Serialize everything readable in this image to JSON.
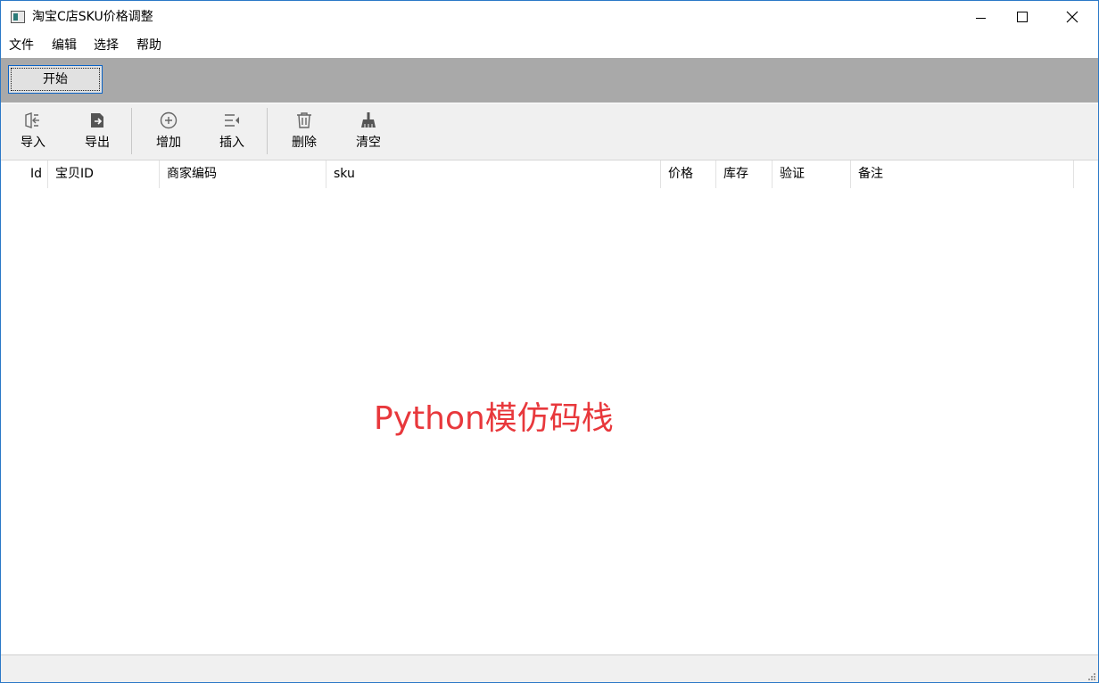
{
  "window": {
    "title": "淘宝C店SKU价格调整"
  },
  "menu": [
    "文件",
    "编辑",
    "选择",
    "帮助"
  ],
  "start_button": "开始",
  "toolbar": {
    "import": "导入",
    "export": "导出",
    "add": "增加",
    "insert": "插入",
    "delete": "删除",
    "clear": "清空"
  },
  "table": {
    "columns": [
      "Id",
      "宝贝ID",
      "商家编码",
      "sku",
      "价格",
      "库存",
      "验证",
      "备注"
    ],
    "rows": []
  },
  "watermark": "Python模仿码栈"
}
